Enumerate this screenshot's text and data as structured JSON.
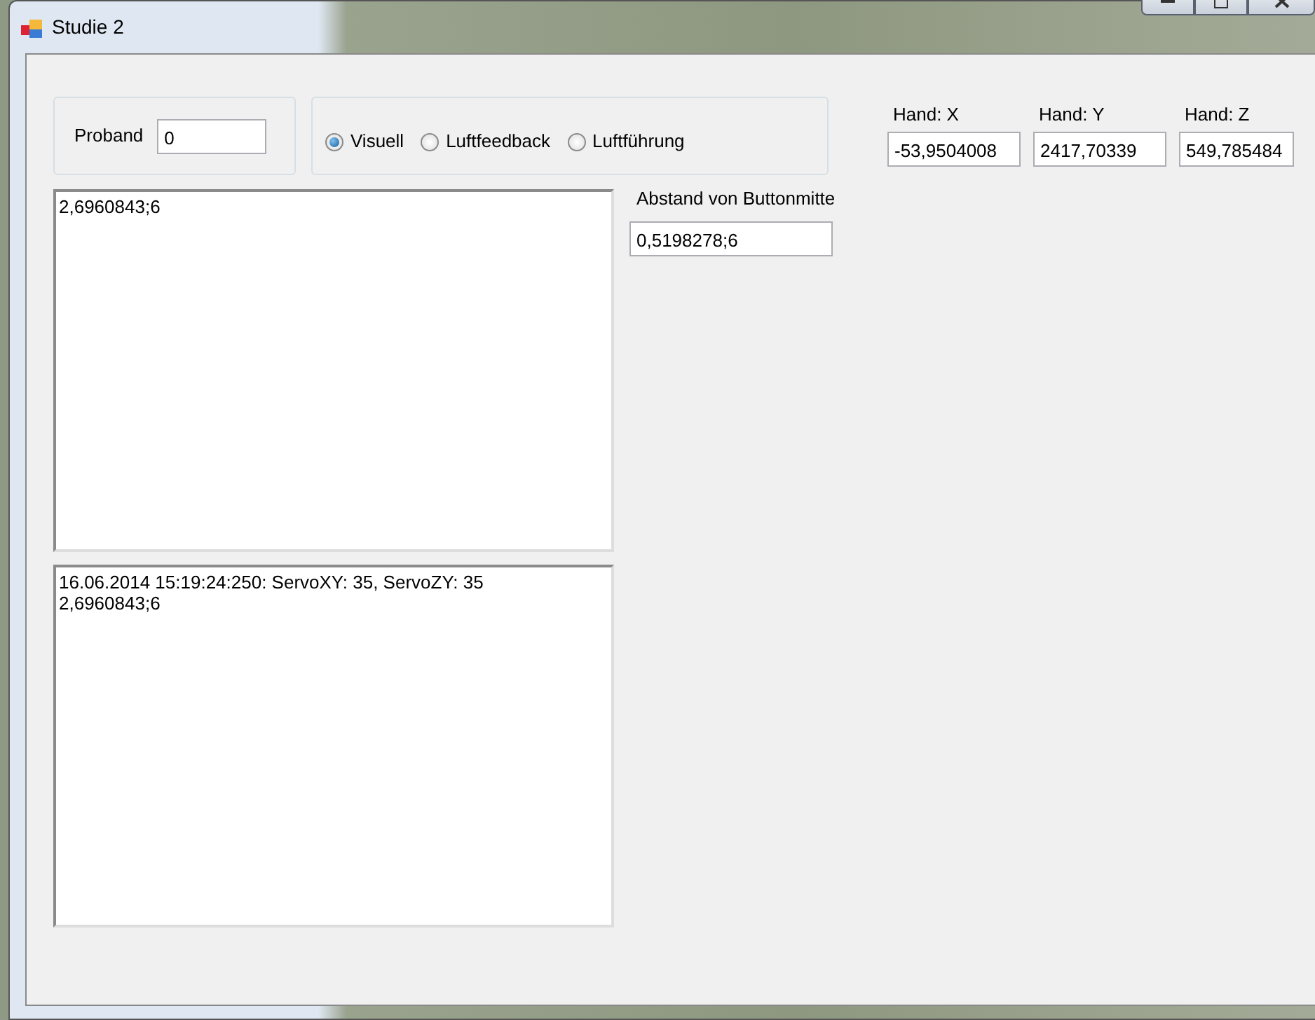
{
  "window": {
    "title": "Studie 2"
  },
  "proband": {
    "label": "Proband",
    "value": "0"
  },
  "modes": [
    {
      "label": "Visuell",
      "selected": true
    },
    {
      "label": "Luftfeedback",
      "selected": false
    },
    {
      "label": "Luftführung",
      "selected": false
    }
  ],
  "hand": [
    {
      "label": "Hand: X",
      "value": "-53,9504008"
    },
    {
      "label": "Hand: Y",
      "value": "2417,70339"
    },
    {
      "label": "Hand: Z",
      "value": "549,785484"
    }
  ],
  "result_box": {
    "lines": [
      "2,6960843;6"
    ]
  },
  "distance": {
    "label": "Abstand von Buttonmitte",
    "value": "0,5198278;6"
  },
  "log_box": {
    "lines": [
      "16.06.2014 15:19:24:250: ServoXY: 35, ServoZY: 35",
      "2,6960843;6"
    ]
  }
}
